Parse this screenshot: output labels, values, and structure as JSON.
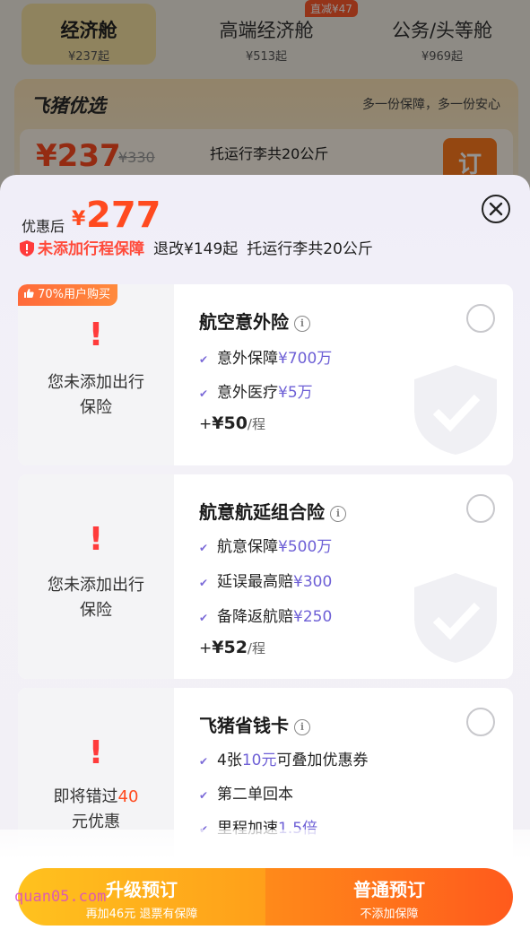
{
  "background": {
    "cabins": [
      {
        "name": "经济舱",
        "price": "¥237起"
      },
      {
        "name": "高端经济舱",
        "price": "¥513起",
        "badge": "直减¥47"
      },
      {
        "name": "公务/头等舱",
        "price": "¥969起"
      }
    ],
    "promo": {
      "title": "飞猪优选",
      "subtitle": "多一份保障，多一份安心",
      "price": "¥237",
      "old_price": "¥330",
      "luggage": "托运行李共20公斤",
      "order_label": "订"
    }
  },
  "sheet": {
    "price_label": "优惠后",
    "currency": "¥",
    "price": "277",
    "warning": "未添加行程保障",
    "change_fee": "退改¥149起",
    "luggage": "托运行李共20公斤",
    "close_icon": "close-circle-icon"
  },
  "insurance": [
    {
      "badge": "70%用户购买",
      "left_text_1": "您未添加出行",
      "left_text_2": "保险",
      "title": "航空意外险",
      "features": [
        {
          "label": "意外保障",
          "value": "¥700万"
        },
        {
          "label": "意外医疗",
          "value": "¥5万"
        }
      ],
      "price_prefix": "+",
      "price": "¥50",
      "unit": "/程",
      "selected": false
    },
    {
      "left_text_1": "您未添加出行",
      "left_text_2": "保险",
      "title": "航意航延组合险",
      "features": [
        {
          "label": "航意保障",
          "value": "¥500万"
        },
        {
          "label": "延误最高赔",
          "value": "¥300"
        },
        {
          "label": "备降返航赔",
          "value": "¥250"
        }
      ],
      "price_prefix": "+",
      "price": "¥52",
      "unit": "/程",
      "selected": false
    },
    {
      "left_text_1": "即将错过",
      "left_text_highlight": "40",
      "left_text_2": "元优惠",
      "title": "飞猪省钱卡",
      "features": [
        {
          "label": "4张",
          "value": "10元",
          "suffix": "可叠加优惠券"
        },
        {
          "label": "第二单回本",
          "value": ""
        },
        {
          "label": "里程加速",
          "value": "1.5倍"
        }
      ],
      "selected": false
    }
  ],
  "bottom": {
    "upgrade_label": "升级预订",
    "upgrade_sub": "再加46元 退票有保障",
    "normal_label": "普通预订",
    "normal_sub": "不添加保障",
    "watermark": "quan05.com"
  },
  "colors": {
    "accent_red": "#ff4a1f",
    "highlight_purple": "#6e60d6",
    "upgrade_gradient": [
      "#ffc21e",
      "#ff9f1a"
    ],
    "normal_gradient": [
      "#ff8a1a",
      "#ff5a1c"
    ]
  }
}
